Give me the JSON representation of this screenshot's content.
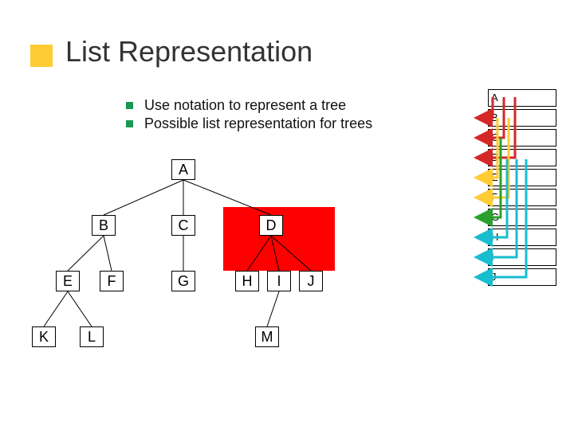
{
  "title": "List Representation",
  "bullets": [
    "Use notation to represent a tree",
    "Possible list representation for trees"
  ],
  "tree": {
    "root": "A",
    "level1": [
      "B",
      "C",
      "D"
    ],
    "level2_b": [
      "E",
      "F"
    ],
    "level2_c": [
      "G"
    ],
    "level2_d": [
      "H",
      "I",
      "J"
    ],
    "level3_e": [
      "K",
      "L"
    ],
    "level3_i": [
      "M"
    ]
  },
  "sidebar": [
    "A",
    "B",
    "C",
    "D",
    "E",
    "F",
    "G",
    "H",
    "I",
    "J"
  ],
  "colors": {
    "accent_square": "#ffcc33",
    "bullet": "#1a9850",
    "highlight": "#ff0000",
    "arrows": [
      "#d62728",
      "#ffcc33",
      "#2ca02c",
      "#17becf"
    ]
  }
}
